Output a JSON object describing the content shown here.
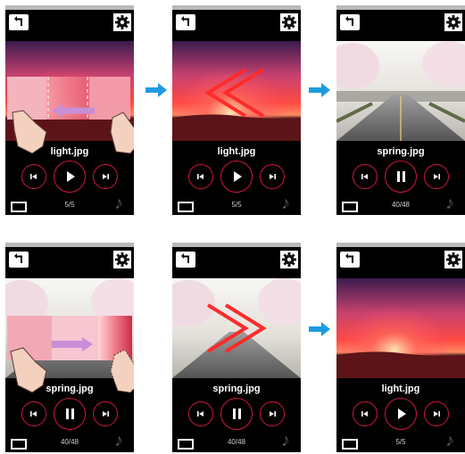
{
  "panels": [
    {
      "filename": "light.jpg",
      "counter": "5/5",
      "state": "play"
    },
    {
      "filename": "light.jpg",
      "counter": "5/5",
      "state": "play"
    },
    {
      "filename": "spring.jpg",
      "counter": "40/48",
      "state": "pause"
    },
    {
      "filename": "spring.jpg",
      "counter": "40/48",
      "state": "pause"
    },
    {
      "filename": "spring.jpg",
      "counter": "40/48",
      "state": "pause"
    },
    {
      "filename": "light.jpg",
      "counter": "5/5",
      "state": "play"
    }
  ],
  "icons": {
    "back": "back-arrow-icon",
    "settings": "gear-icon",
    "previous": "previous-track-icon",
    "play": "play-icon",
    "pause": "pause-icon",
    "next": "next-track-icon",
    "screen": "screen-icon",
    "music": "music-note-icon",
    "flow": "right-arrow-icon"
  },
  "colors": {
    "accent": "#d2173b",
    "flow_arrow": "#1e9be0"
  }
}
